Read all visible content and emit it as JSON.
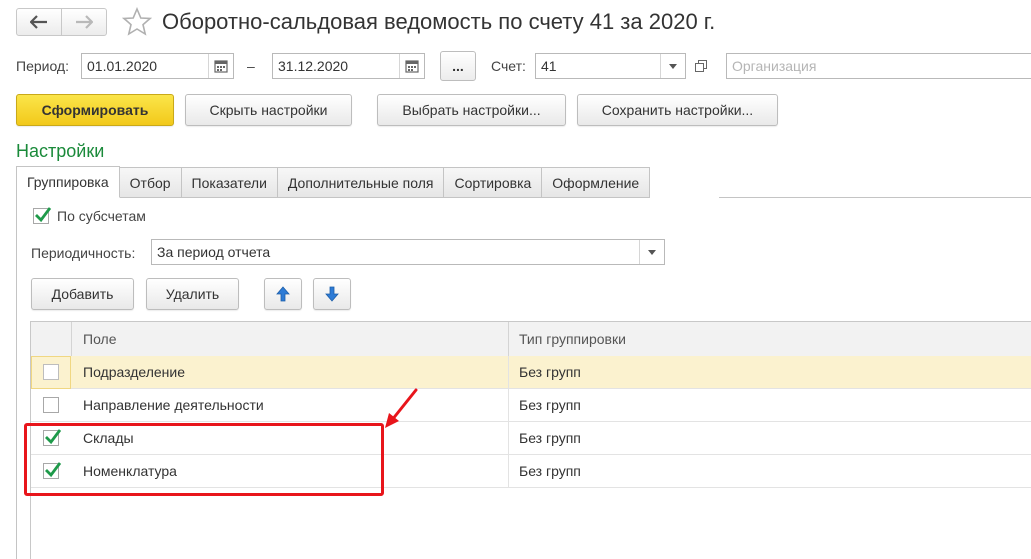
{
  "window": {
    "title": "Оборотно-сальдовая ведомость по счету 41 за 2020 г.",
    "back_icon": "arrow-left-icon",
    "forward_icon": "arrow-right-icon",
    "favorite_icon": "star-icon"
  },
  "filters": {
    "period_label": "Период:",
    "period_from": "01.01.2020",
    "period_dash": "–",
    "period_to": "31.12.2020",
    "period_more": "...",
    "account_label": "Счет:",
    "account_value": "41",
    "organization_placeholder": "Организация"
  },
  "toolbar": {
    "generate": "Сформировать",
    "hide_settings": "Скрыть настройки",
    "choose_settings": "Выбрать настройки...",
    "save_settings": "Сохранить настройки..."
  },
  "settings": {
    "title": "Настройки",
    "tabs": [
      {
        "label": "Группировка",
        "active": true
      },
      {
        "label": "Отбор"
      },
      {
        "label": "Показатели"
      },
      {
        "label": "Дополнительные поля"
      },
      {
        "label": "Сортировка"
      },
      {
        "label": "Оформление"
      }
    ],
    "by_subaccounts": {
      "label": "По субсчетам",
      "checked": true
    },
    "periodicity_label": "Периодичность:",
    "periodicity_value": "За период отчета",
    "add_button": "Добавить",
    "delete_button": "Удалить",
    "move_up_icon": "arrow-up-icon",
    "move_down_icon": "arrow-down-icon",
    "grid": {
      "columns": [
        "Поле",
        "Тип группировки"
      ],
      "rows": [
        {
          "checked": false,
          "field": "Подразделение",
          "type": "Без групп",
          "selected": true
        },
        {
          "checked": false,
          "field": "Направление деятельности",
          "type": "Без групп"
        },
        {
          "checked": true,
          "field": "Склады",
          "type": "Без групп"
        },
        {
          "checked": true,
          "field": "Номенклатура",
          "type": "Без групп"
        }
      ]
    }
  },
  "colors": {
    "accent_green": "#1a8a3a",
    "primary_button": "#f5d12a",
    "highlight_red": "#e8151b",
    "arrow_blue": "#2d7bd6",
    "selected_row": "#fbf2cf"
  }
}
